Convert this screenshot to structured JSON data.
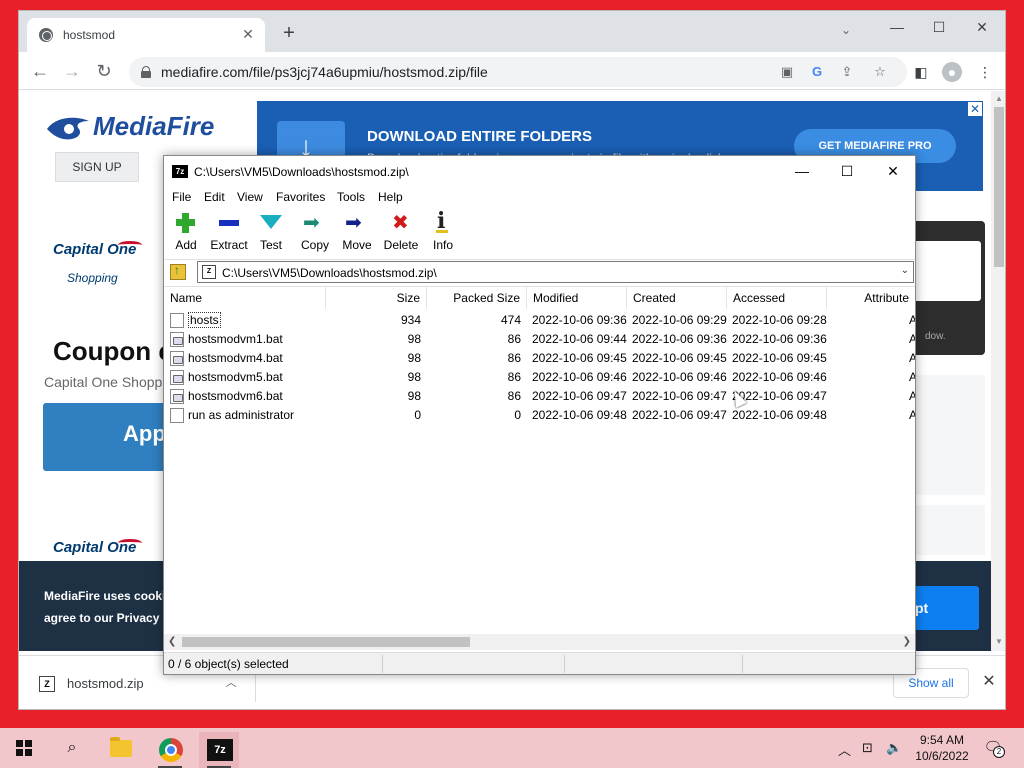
{
  "chrome": {
    "tab_title": "hostsmod",
    "url": "mediafire.com/file/ps3jcj74a6upmiu/hostsmod.zip/file"
  },
  "webpage": {
    "logo_text": "MediaFire",
    "signup_label": "SIGN UP",
    "ad_headline": "DOWNLOAD ENTIRE FOLDERS",
    "ad_subline": "Download entire folders in one convenient zip file with a single click.",
    "ad_cta": "GET MEDIAFIRE PRO",
    "capital_one_logo": "Capital One",
    "capital_one_shopping": "Shopping",
    "coupon_heading": "Coupon c",
    "coupon_sub": "Capital One Shoppi",
    "app_button": "App",
    "right_panel_hint": "dow.",
    "cookie_line1": "MediaFire uses cooki",
    "cookie_line2": "agree to our Privacy",
    "cookie_accept": "pt"
  },
  "download_shelf": {
    "filename": "hostsmod.zip",
    "show_all": "Show all"
  },
  "sevenzip": {
    "title": "C:\\Users\\VM5\\Downloads\\hostsmod.zip\\",
    "app_icon_text": "7z",
    "menu": [
      "File",
      "Edit",
      "View",
      "Favorites",
      "Tools",
      "Help"
    ],
    "toolbar": [
      "Add",
      "Extract",
      "Test",
      "Copy",
      "Move",
      "Delete",
      "Info"
    ],
    "address": "C:\\Users\\VM5\\Downloads\\hostsmod.zip\\",
    "columns": [
      "Name",
      "Size",
      "Packed Size",
      "Modified",
      "Created",
      "Accessed",
      "Attribute"
    ],
    "rows": [
      {
        "name": "hosts",
        "size": "934",
        "packed": "474",
        "modified": "2022-10-06 09:36",
        "created": "2022-10-06 09:29",
        "accessed": "2022-10-06 09:28",
        "attr": "A",
        "type": "file"
      },
      {
        "name": "hostsmodvm1.bat",
        "size": "98",
        "packed": "86",
        "modified": "2022-10-06 09:44",
        "created": "2022-10-06 09:36",
        "accessed": "2022-10-06 09:36",
        "attr": "A",
        "type": "bat"
      },
      {
        "name": "hostsmodvm4.bat",
        "size": "98",
        "packed": "86",
        "modified": "2022-10-06 09:45",
        "created": "2022-10-06 09:45",
        "accessed": "2022-10-06 09:45",
        "attr": "A",
        "type": "bat"
      },
      {
        "name": "hostsmodvm5.bat",
        "size": "98",
        "packed": "86",
        "modified": "2022-10-06 09:46",
        "created": "2022-10-06 09:46",
        "accessed": "2022-10-06 09:46",
        "attr": "A",
        "type": "bat"
      },
      {
        "name": "hostsmodvm6.bat",
        "size": "98",
        "packed": "86",
        "modified": "2022-10-06 09:47",
        "created": "2022-10-06 09:47",
        "accessed": "2022-10-06 09:47",
        "attr": "A",
        "type": "bat"
      },
      {
        "name": "run as administrator",
        "size": "0",
        "packed": "0",
        "modified": "2022-10-06 09:48",
        "created": "2022-10-06 09:47",
        "accessed": "2022-10-06 09:48",
        "attr": "A",
        "type": "file"
      }
    ],
    "status": "0 / 6 object(s) selected"
  },
  "taskbar": {
    "sevenzip_label": "7z",
    "time": "9:54 AM",
    "date": "10/6/2022",
    "notification_count": "2"
  }
}
